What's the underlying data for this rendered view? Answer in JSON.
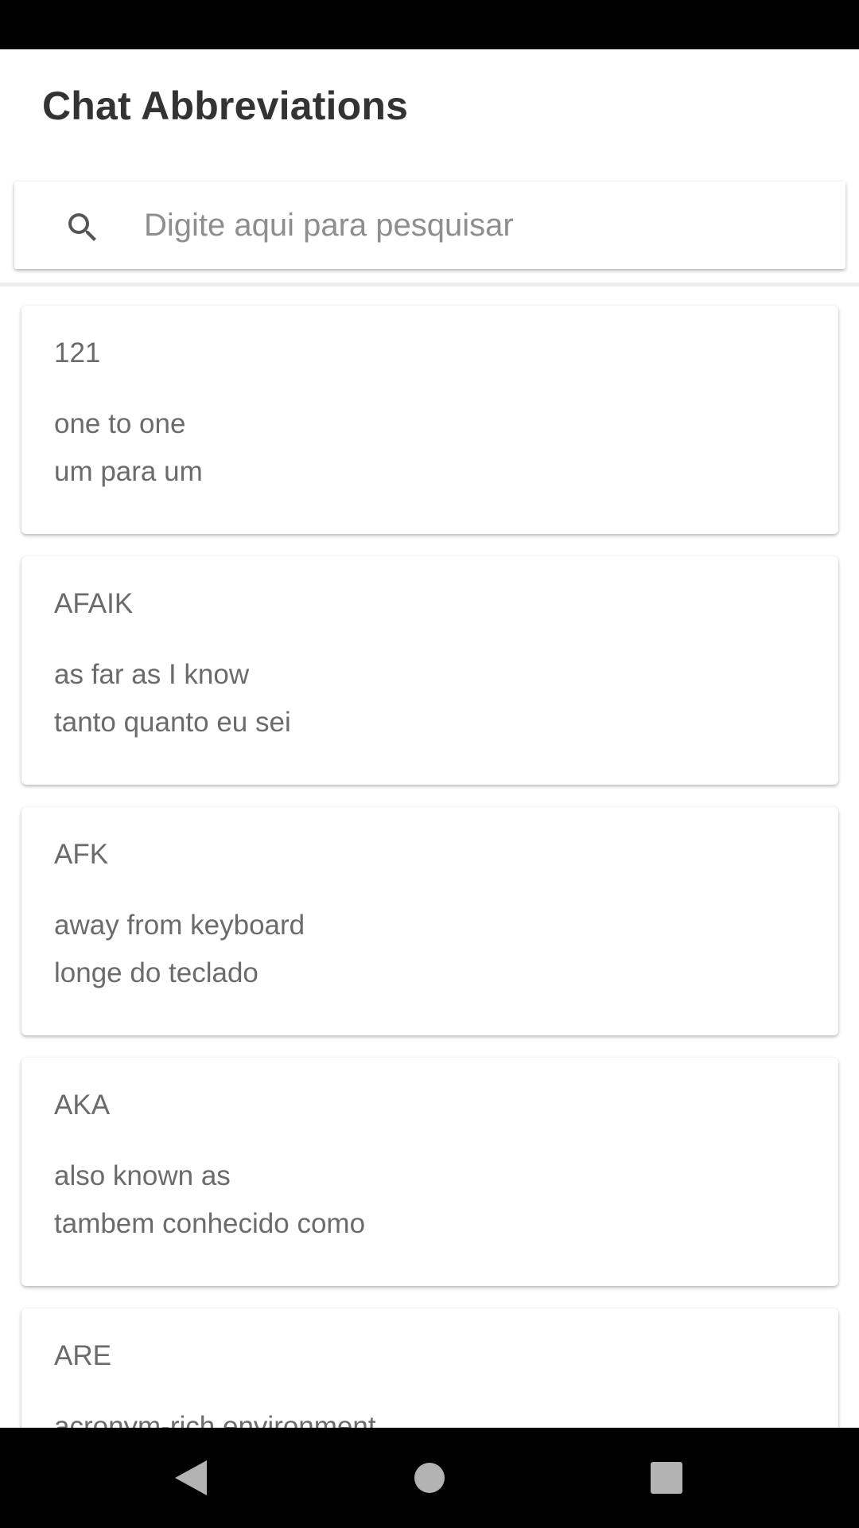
{
  "app": {
    "title": "Chat Abbreviations"
  },
  "search": {
    "placeholder": "Digite aqui para pesquisar",
    "value": "",
    "icon": "search-icon"
  },
  "items": [
    {
      "abbr": "121",
      "english": "one to one",
      "portuguese": "um para um"
    },
    {
      "abbr": "AFAIK",
      "english": "as far as I know",
      "portuguese": "tanto quanto eu sei"
    },
    {
      "abbr": "AFK",
      "english": "away from keyboard",
      "portuguese": "longe do teclado"
    },
    {
      "abbr": "AKA",
      "english": "also known as",
      "portuguese": "tambem conhecido como"
    },
    {
      "abbr": "ARE",
      "english": "acronym-rich environment",
      "portuguese": ""
    }
  ],
  "navigation": {
    "back_icon": "back-triangle-icon",
    "home_icon": "home-circle-icon",
    "recents_icon": "recents-square-icon"
  },
  "colors": {
    "status_bar": "#000000",
    "nav_bar": "#000000",
    "title_text": "#333333",
    "card_text": "#6b6b6b",
    "placeholder": "#8e8e8e",
    "nav_icons": "#b3b3b3"
  }
}
